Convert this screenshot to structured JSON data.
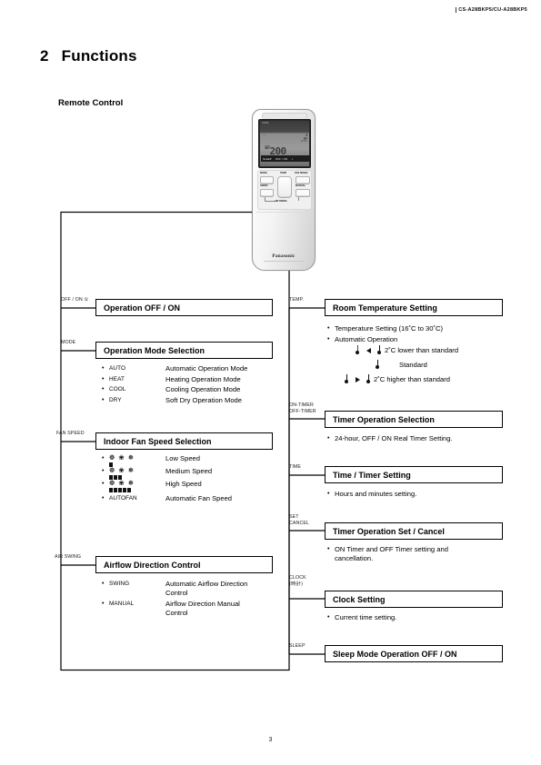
{
  "header": {
    "model": "CS-A28BKP5/CU-A28BKP5"
  },
  "chapter": {
    "number": "2",
    "title": "Functions"
  },
  "section": {
    "title": "Remote Control"
  },
  "remote": {
    "brand": "Panasonic",
    "lcd": {
      "mode_tag": "COOL",
      "left_icon": "♡",
      "right_icon": "❄",
      "bar_top": "▮▮▮",
      "bar_bottom": "AUTO",
      "temp_prefix": "SET",
      "temp_value": "20",
      "temp_suffix": "0",
      "sleep_label": "SLEEP",
      "offon_label": "OFF / ON",
      "offon_icon": "◑",
      "foot_label": "TIMER"
    },
    "buttons": {
      "mode": "MODE",
      "temp": "TEMP",
      "fan_speed": "FAN SPEED",
      "swing": "SWING",
      "manual": "MANUAL",
      "air_swing": "AIR SWING"
    }
  },
  "left_column": {
    "items": [
      {
        "tag": "OFF / ON ①",
        "title": "Operation OFF / ON",
        "bullets": []
      },
      {
        "tag": "MODE",
        "title": "Operation Mode Selection",
        "bullets": [
          {
            "key": "AUTO",
            "text": "Automatic Operation Mode"
          },
          {
            "key": "HEAT",
            "text": "Heating Operation Mode"
          },
          {
            "key": "COOL",
            "text": "Cooling Operation Mode"
          },
          {
            "key": "DRY",
            "text": "Soft Dry Operation Mode"
          }
        ]
      },
      {
        "tag": "FAN SPEED",
        "title": "Indoor Fan Speed Selection",
        "fan_rows": [
          {
            "icons": [
              "❁",
              "❀",
              "❅"
            ],
            "bars": 1,
            "text": "Low Speed"
          },
          {
            "icons": [
              "❁",
              "❀",
              "❅"
            ],
            "bars": 3,
            "text": "Medium Speed"
          },
          {
            "icons": [
              "❁",
              "❀",
              "❅"
            ],
            "bars": 5,
            "text": "High Speed"
          }
        ],
        "last_row": {
          "key": "AUTOFAN",
          "text": "Automatic Fan Speed"
        }
      },
      {
        "tag": "AIR SWING",
        "title": "Airflow Direction Control",
        "bullets": [
          {
            "key": "SWING",
            "text": "Automatic Airflow Direction Control"
          },
          {
            "key": "MANUAL",
            "text": "Airflow Direction Manual Control"
          }
        ]
      }
    ]
  },
  "right_column": {
    "items": [
      {
        "tag": "TEMP.",
        "title": "Room Temperature Setting",
        "bullets": [
          {
            "text": "Temperature Setting (16˚C to 30˚C)"
          },
          {
            "text": "Automatic Operation"
          }
        ],
        "temp_rows": [
          {
            "arrow": "left",
            "text": "2˚C lower than standard"
          },
          {
            "arrow": "none",
            "text": "Standard"
          },
          {
            "arrow": "right",
            "text": "2˚C higher than standard"
          }
        ]
      },
      {
        "tag": "ON-TIMER\nOFF-TIMER",
        "tag_line1": "ON-TIMER",
        "tag_line2": "OFF-TIMER",
        "title": "Timer Operation Selection",
        "bullets": [
          {
            "text": "24-hour, OFF / ON Real Timer Setting."
          }
        ]
      },
      {
        "tag": "TIME",
        "title": "Time / Timer Setting",
        "bullets": [
          {
            "text": "Hours and minutes setting."
          }
        ]
      },
      {
        "tag_line1": "SET",
        "tag_line2": "CANCEL",
        "title": "Timer Operation Set / Cancel",
        "bullets": [
          {
            "text": "ON Timer and OFF Timer setting and cancellation."
          }
        ]
      },
      {
        "tag_line1": "CLOCK",
        "tag_line2": "(時計)",
        "title": "Clock Setting",
        "bullets": [
          {
            "text": "Current time setting."
          }
        ]
      },
      {
        "tag_line1": "SLEEP",
        "title": "Sleep Mode Operation OFF / ON",
        "bullets": []
      }
    ]
  },
  "footer": {
    "page_number": "3"
  }
}
